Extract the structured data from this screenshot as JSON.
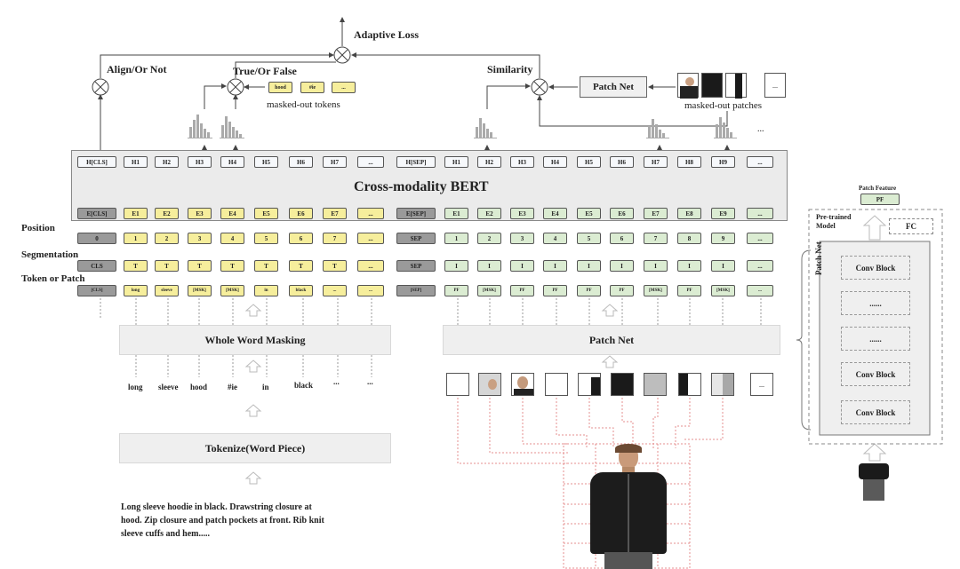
{
  "loss": {
    "adaptive": "Adaptive Loss",
    "align": "Align/Or Not",
    "truefalse": "True/Or False",
    "similarity": "Similarity"
  },
  "patch_net_small": "Patch Net",
  "masked_tokens": {
    "chips": [
      "hood",
      "#ie",
      "..."
    ],
    "caption": "masked-out tokens"
  },
  "masked_patches_caption": "masked-out patches",
  "ellipsis": "...",
  "bert_title": "Cross-modality BERT",
  "hidden_row": [
    "H[CLS]",
    "H1",
    "H2",
    "H3",
    "H4",
    "H5",
    "H6",
    "H7",
    "...",
    "H[SEP]",
    "H1",
    "H2",
    "H3",
    "H4",
    "H5",
    "H6",
    "H7",
    "H8",
    "H9",
    "..."
  ],
  "embed_row": [
    "E[CLS]",
    "E1",
    "E2",
    "E3",
    "E4",
    "E5",
    "E6",
    "E7",
    "...",
    "E[SEP]",
    "E1",
    "E2",
    "E3",
    "E4",
    "E5",
    "E6",
    "E7",
    "E8",
    "E9",
    "..."
  ],
  "position_row": [
    "0",
    "1",
    "2",
    "3",
    "4",
    "5",
    "6",
    "7",
    "...",
    "SEP",
    "1",
    "2",
    "3",
    "4",
    "5",
    "6",
    "7",
    "8",
    "9",
    "..."
  ],
  "segment_row": [
    "CLS",
    "T",
    "T",
    "T",
    "T",
    "T",
    "T",
    "T",
    "...",
    "SEP",
    "I",
    "I",
    "I",
    "I",
    "I",
    "I",
    "I",
    "I",
    "I",
    "..."
  ],
  "token_row": [
    "[CLS]",
    "long",
    "sleeve",
    "[MSK]",
    "[MSK]",
    "in",
    "black",
    "...",
    "...",
    "[SEP]",
    "PF",
    "[MSK]",
    "PF",
    "PF",
    "PF",
    "PF",
    "[MSK]",
    "PF",
    "[MSK]",
    "..."
  ],
  "row_labels": {
    "position": "Position",
    "segmentation": "Segmentation",
    "token": "Token or Patch"
  },
  "wwm": "Whole Word Masking",
  "patch_net": "Patch Net",
  "words": [
    "long",
    "sleeve",
    "hood",
    "#ie",
    "in",
    "black",
    "...",
    "..."
  ],
  "tokenize": "Tokenize(Word Piece)",
  "text": {
    "line1": "Long sleeve hoodie in black. Drawstring closure at",
    "line2": "hood. Zip closure and patch pockets at front. Rib knit",
    "line3": "sleeve cuffs and hem....."
  },
  "side": {
    "patch_feature": "Patch Feature",
    "pf": "PF",
    "pretrained": "Pre-trained Model",
    "fc": "FC",
    "patch_net_vertical": "Patch Net",
    "blocks": [
      "Conv Block",
      "......",
      "......",
      "Conv Block",
      "Conv Block"
    ]
  },
  "colors": {
    "text_token": "#f6ee9c",
    "image_token": "#dbecd2",
    "special_token": "#9a9a9a",
    "panel": "#efefef"
  }
}
